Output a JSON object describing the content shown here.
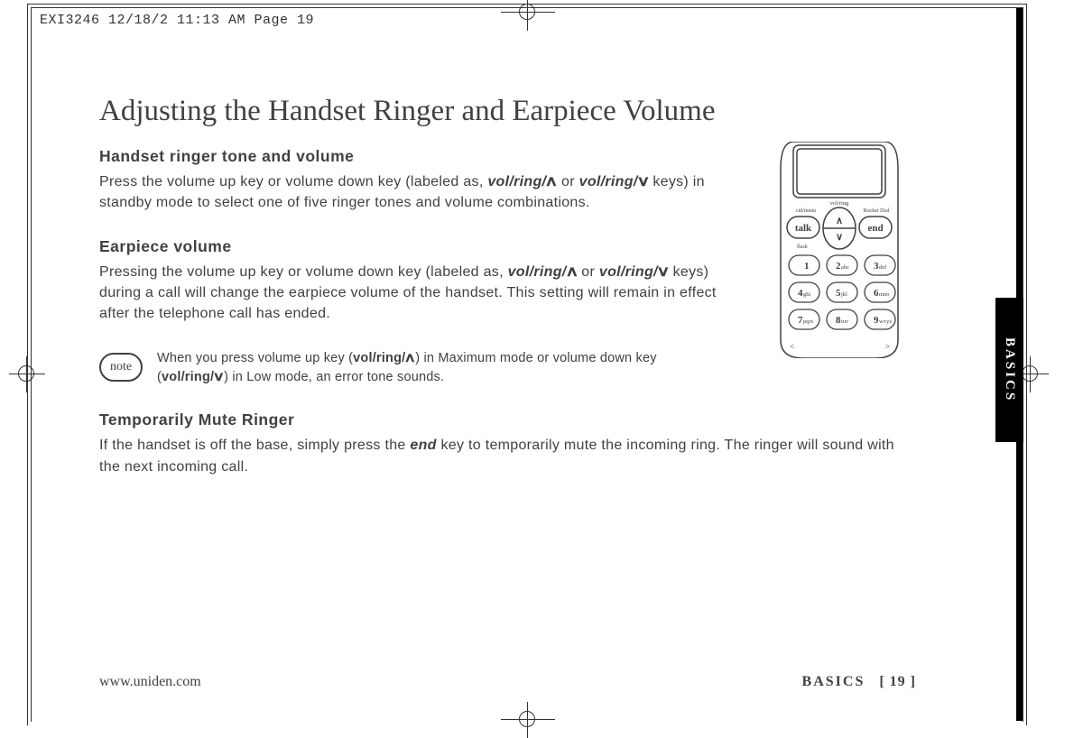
{
  "meta": {
    "header_line": "EXI3246  12/18/2  11:13 AM  Page 19"
  },
  "sidebar": {
    "tab_label": "BASICS"
  },
  "content": {
    "title": "Adjusting the Handset Ringer and Earpiece Volume",
    "section1": {
      "heading": "Handset ringer tone and volume",
      "body_pre": "Press the volume up key or volume down key (labeled as, ",
      "vol_up": "vol/ring/",
      "or": " or ",
      "vol_down": "vol/ring/",
      "body_post": " keys) in standby mode to select one of five ringer tones and volume combinations."
    },
    "section2": {
      "heading": "Earpiece volume",
      "body_pre": "Pressing the volume up key or volume down key (labeled as, ",
      "vol_up": "vol/ring/",
      "or": " or ",
      "vol_down": "vol/ring/",
      "body_post": " keys) during a call will change the earpiece volume of the handset. This setting will remain in effect after the telephone call has ended."
    },
    "note": {
      "badge": "note",
      "text_pre": "When you press volume up key (",
      "vol_up": "vol/ring/",
      "text_mid": ") in Maximum mode or volume down key (",
      "vol_down": "vol/ring/",
      "text_post": ") in Low mode, an error tone sounds."
    },
    "section3": {
      "heading": "Temporarily Mute Ringer",
      "body_pre": "If the handset is off the base, simply press the ",
      "endkey": "end",
      "body_post": " key to temporarily mute the incoming ring. The ringer will sound with the next incoming call."
    },
    "phone": {
      "labels": {
        "vol_ring": "vol/ring",
        "cid_menu": "cid/menu",
        "rocket_dial": "Rocket Dial",
        "talk": "talk",
        "end": "end",
        "flash": "flash"
      },
      "keypad": [
        {
          "n": "1",
          "l": ""
        },
        {
          "n": "2",
          "l": "abc"
        },
        {
          "n": "3",
          "l": "def"
        },
        {
          "n": "4",
          "l": "ghi"
        },
        {
          "n": "5",
          "l": "jkl"
        },
        {
          "n": "6",
          "l": "mno"
        },
        {
          "n": "7",
          "l": "pqrs"
        },
        {
          "n": "8",
          "l": "tuv"
        },
        {
          "n": "9",
          "l": "wxyz"
        }
      ],
      "angles": {
        "left": "<",
        "right": ">"
      }
    }
  },
  "footer": {
    "url": "www.uniden.com",
    "section": "BASICS",
    "page": "[ 19 ]"
  }
}
